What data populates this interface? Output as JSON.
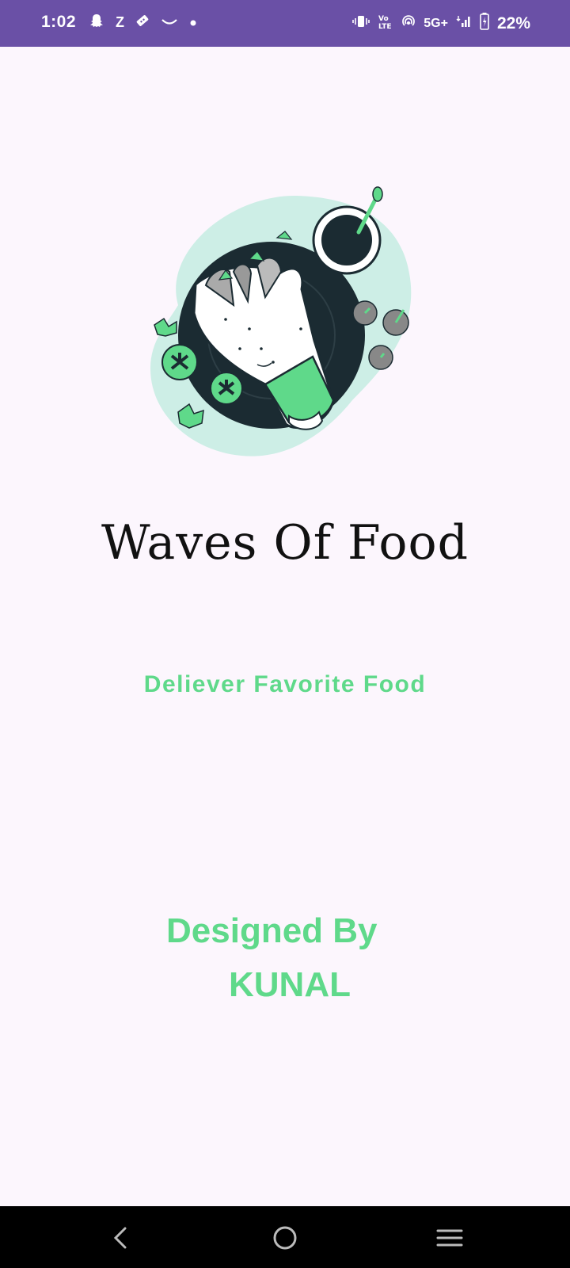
{
  "status_bar": {
    "time": "1:02",
    "left_icons": [
      "snapchat-icon",
      "z-icon",
      "ticket-icon",
      "smile-icon",
      "dot-icon"
    ],
    "network_label": "5G+",
    "battery_percent": "22%",
    "color": "#6a50a6"
  },
  "splash": {
    "title": "Waves Of Food",
    "tagline": "Deliever Favorite Food",
    "designed_by": "Designed By",
    "designer_name": "KUNAL"
  },
  "colors": {
    "accent": "#5fd98a",
    "background": "#fcf6fd",
    "illustration_dark": "#1b2b32",
    "illustration_light": "#cdeee6"
  },
  "nav_bar": {
    "buttons": [
      "back-icon",
      "home-icon",
      "menu-icon"
    ]
  }
}
